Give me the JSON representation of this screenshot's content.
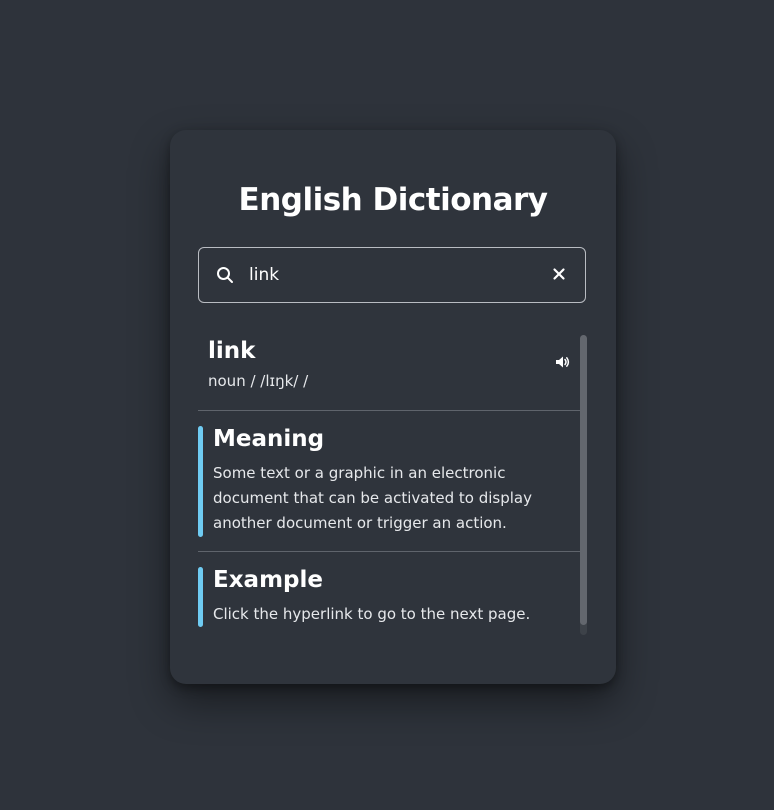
{
  "app": {
    "title": "English Dictionary"
  },
  "search": {
    "value": "link",
    "placeholder": "",
    "icon": "search-icon",
    "clear_icon": "close-icon"
  },
  "result": {
    "word": "link",
    "phonetic": "noun / /lɪŋk/ /",
    "audio_icon": "speaker-icon"
  },
  "meaning": {
    "heading": "Meaning",
    "text": "Some text or a graphic in an electronic document that can be activated to display another document or trigger an action."
  },
  "example": {
    "heading": "Example",
    "text": "Click the hyperlink to go to the next page."
  },
  "colors": {
    "background": "#2e333b",
    "card": "#2f343c",
    "accent": "#6fcbf2",
    "text": "#ffffff"
  }
}
